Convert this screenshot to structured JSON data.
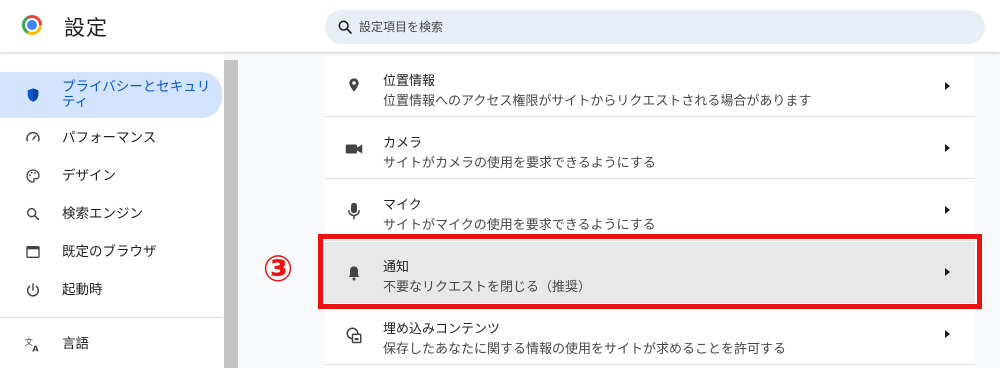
{
  "header": {
    "title": "設定",
    "search_placeholder": "設定項目を検索"
  },
  "sidebar": {
    "items": [
      {
        "label": "プライバシーとセキュリティ",
        "icon": "shield-icon",
        "active": true
      },
      {
        "label": "パフォーマンス",
        "icon": "speedometer-icon"
      },
      {
        "label": "デザイン",
        "icon": "palette-icon"
      },
      {
        "label": "検索エンジン",
        "icon": "search-icon"
      },
      {
        "label": "既定のブラウザ",
        "icon": "browser-window-icon"
      },
      {
        "label": "起動時",
        "icon": "power-icon"
      },
      {
        "label": "言語",
        "icon": "translate-icon"
      }
    ]
  },
  "permissions": [
    {
      "title": "位置情報",
      "desc": "位置情報へのアクセス権限がサイトからリクエストされる場合があります",
      "icon": "location-pin-icon"
    },
    {
      "title": "カメラ",
      "desc": "サイトがカメラの使用を要求できるようにする",
      "icon": "camera-icon"
    },
    {
      "title": "マイク",
      "desc": "サイトがマイクの使用を要求できるようにする",
      "icon": "microphone-icon"
    },
    {
      "title": "通知",
      "desc": "不要なリクエストを閉じる（推奨）",
      "icon": "bell-icon",
      "highlighted": true
    },
    {
      "title": "埋め込みコンテンツ",
      "desc": "保存したあなたに関する情報の使用をサイトが求めることを許可する",
      "icon": "embedded-content-icon"
    }
  ],
  "annotation": {
    "step_label": "③",
    "color": "#ee1111"
  },
  "colors": {
    "accent": "#0b57d0",
    "active_bg": "#d3e3fd",
    "search_bg": "#e9eef6"
  }
}
